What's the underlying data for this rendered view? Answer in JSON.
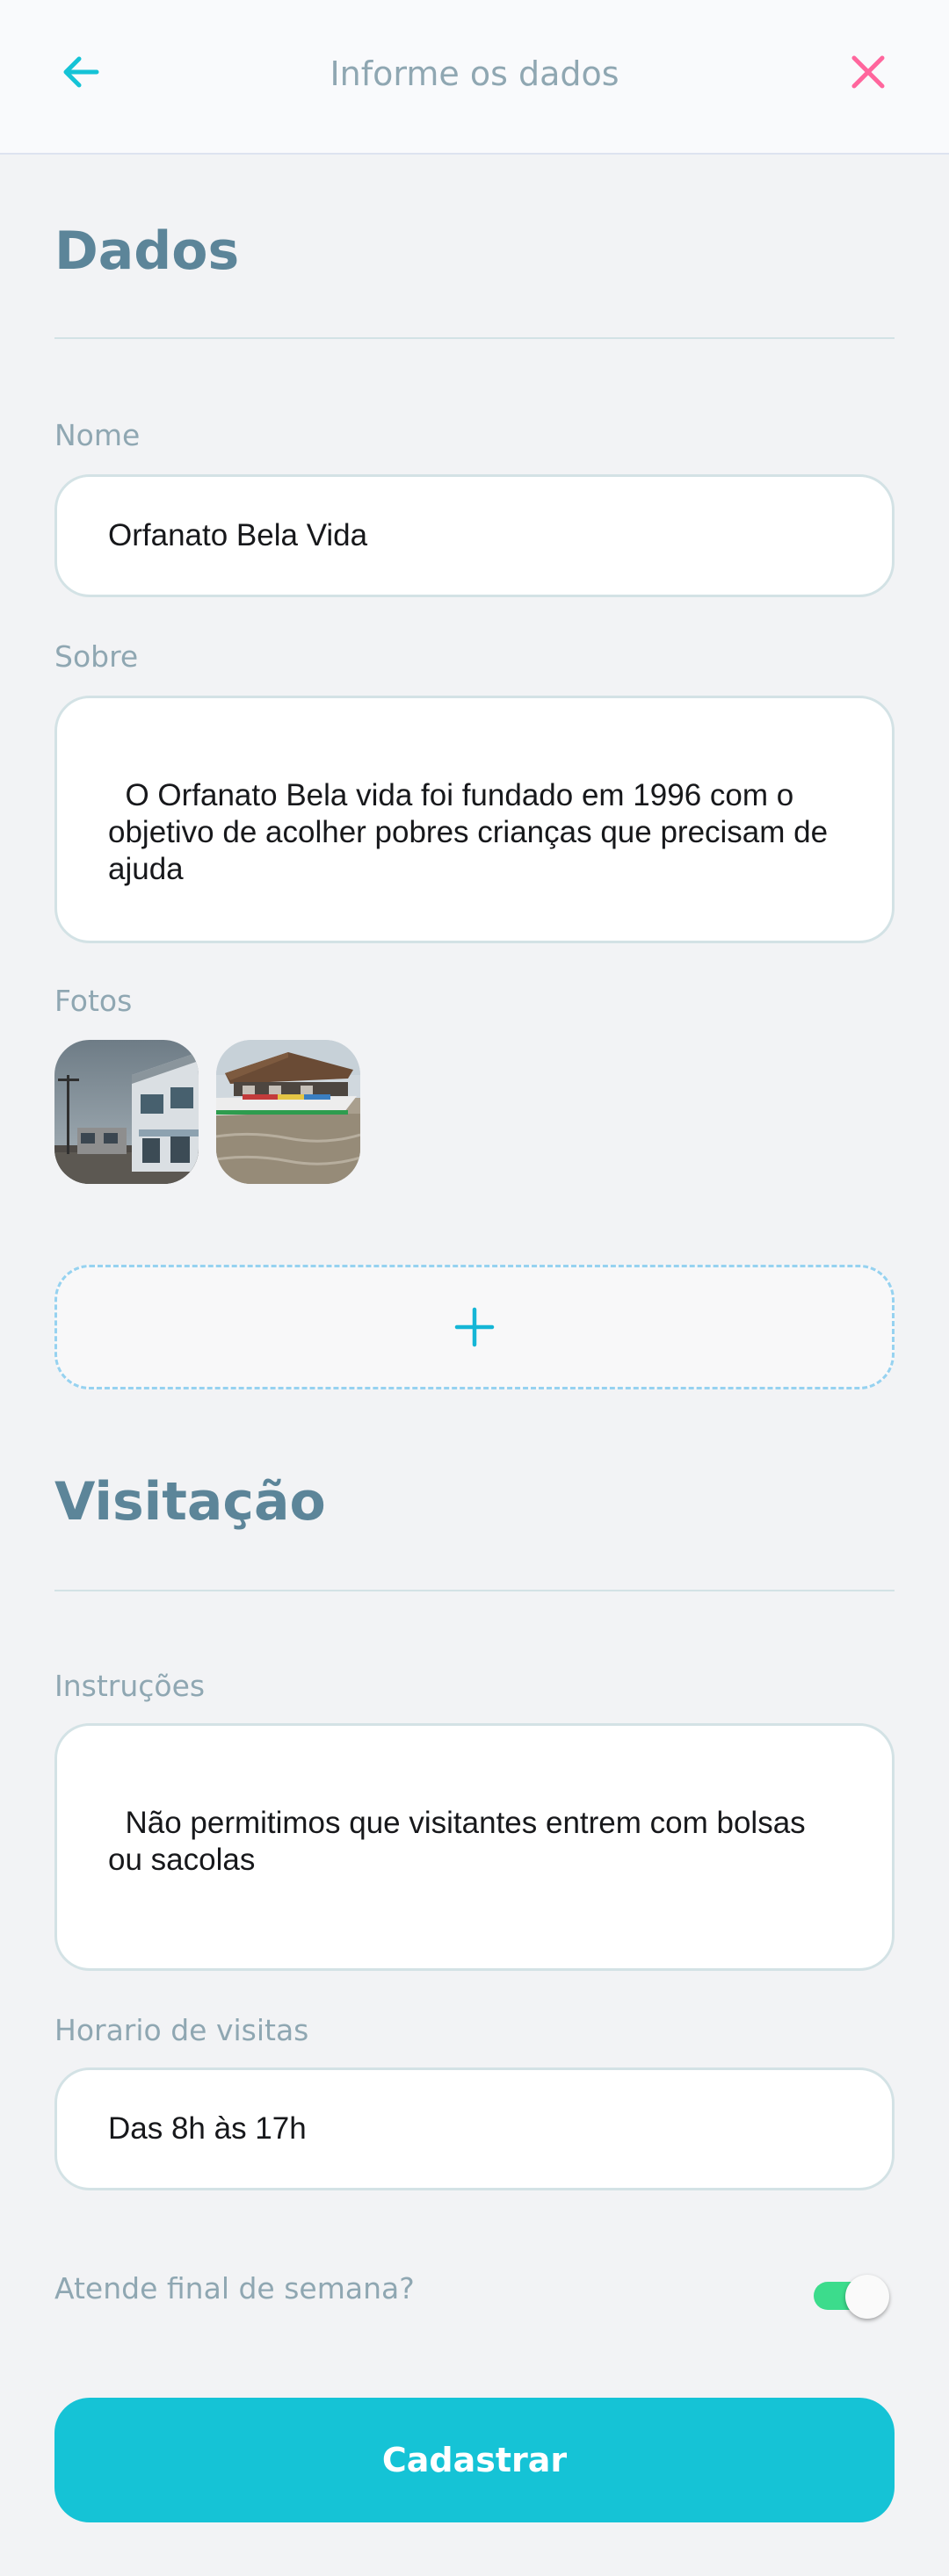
{
  "header": {
    "title": "Informe os dados",
    "back_icon": "arrow-left-icon",
    "close_icon": "close-icon",
    "accent_color": "#15C3D6",
    "close_color": "#FF669D"
  },
  "dados": {
    "section_title": "Dados",
    "nome_label": "Nome",
    "nome_value": "Orfanato Bela Vida",
    "sobre_label": "Sobre",
    "sobre_value": "O Orfanato Bela vida foi fundado em 1996 com o objetivo de acolher pobres crianças que precisam de ajuda",
    "fotos_label": "Fotos",
    "add_photo_icon": "plus-icon"
  },
  "visitacao": {
    "section_title": "Visitação",
    "instrucoes_label": "Instruções",
    "instrucoes_value": "Não permitimos que visitantes entrem com bolsas ou sacolas",
    "horario_label": "Horario de visitas",
    "horario_value": "Das 8h às 17h",
    "weekend_label": "Atende final de semana?",
    "weekend_open": true
  },
  "submit": {
    "label": "Cadastrar",
    "color": "#15C3D6"
  }
}
